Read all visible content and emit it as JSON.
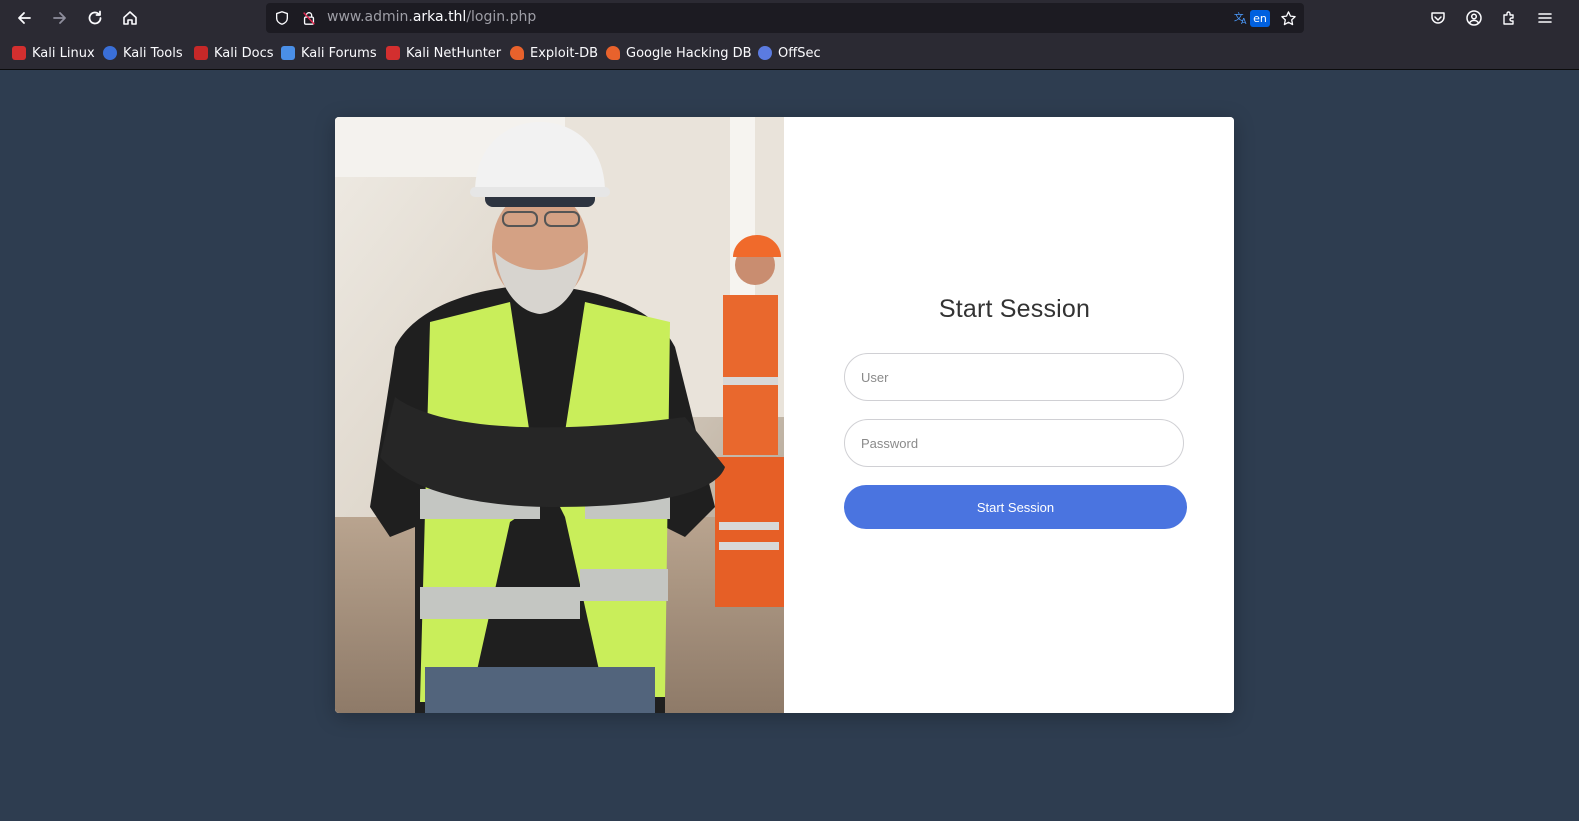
{
  "browser": {
    "url_prefix": "www.admin.",
    "url_host": "arka.thl",
    "url_path": "/login.php",
    "translate_badge": "en"
  },
  "bookmarks": [
    {
      "label": "Kali Linux",
      "color": "#d32f2f"
    },
    {
      "label": "Kali Tools",
      "color": "#3a6fd8"
    },
    {
      "label": "Kali Docs",
      "color": "#c62828"
    },
    {
      "label": "Kali Forums",
      "color": "#4a8fe7"
    },
    {
      "label": "Kali NetHunter",
      "color": "#d32f2f"
    },
    {
      "label": "Exploit-DB",
      "color": "#e8622c"
    },
    {
      "label": "Google Hacking DB",
      "color": "#e8622c"
    },
    {
      "label": "OffSec",
      "color": "#5b7be0"
    }
  ],
  "login": {
    "title": "Start Session",
    "user_placeholder": "User",
    "password_placeholder": "Password",
    "submit_label": "Start Session"
  },
  "colors": {
    "page_background": "#2e3d50",
    "button": "#4a74e0"
  }
}
